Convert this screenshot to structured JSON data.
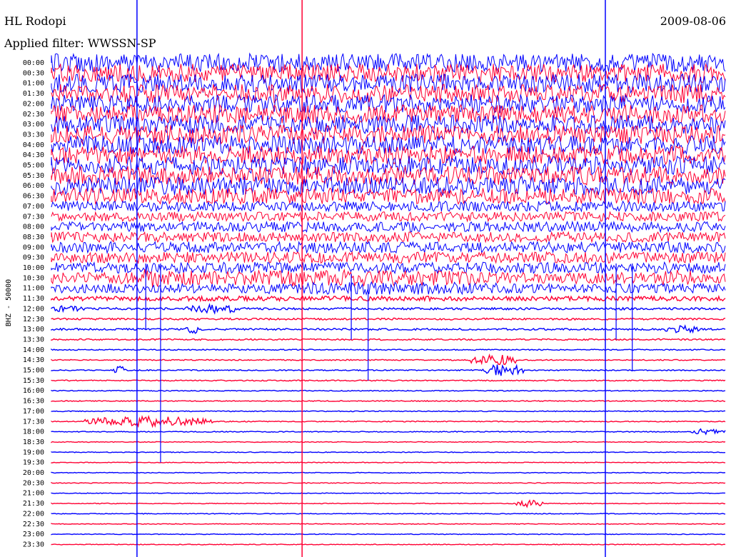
{
  "header": {
    "station": "HL Rodopi",
    "filter_text": "Applied filter: WWSSN-SP",
    "date": "2009-08-06"
  },
  "chart_data": {
    "type": "helicorder",
    "title": "HL Rodopi",
    "date": "2009-08-06",
    "filter": "WWSSN-SP",
    "channel_label": "BHZ - 50000",
    "row_interval_minutes": 30,
    "row_labels": [
      "00:00",
      "00:30",
      "01:00",
      "01:30",
      "02:00",
      "02:30",
      "03:00",
      "03:30",
      "04:00",
      "04:30",
      "05:00",
      "05:30",
      "06:00",
      "06:30",
      "07:00",
      "07:30",
      "08:00",
      "08:30",
      "09:00",
      "09:30",
      "10:00",
      "10:30",
      "11:00",
      "11:30",
      "12:00",
      "12:30",
      "13:00",
      "13:30",
      "14:00",
      "14:30",
      "15:00",
      "15:30",
      "16:00",
      "16:30",
      "17:00",
      "17:30",
      "18:00",
      "18:30",
      "19:00",
      "19:30",
      "20:00",
      "20:30",
      "21:00",
      "21:30",
      "22:00",
      "22:30",
      "23:00",
      "23:30"
    ],
    "trace_colors": [
      "#0000ff",
      "#ff0033"
    ],
    "row_noise_amplitude": [
      1.0,
      1.0,
      1.0,
      1.0,
      1.0,
      1.0,
      1.0,
      1.0,
      1.0,
      1.0,
      1.0,
      1.0,
      1.0,
      0.85,
      0.55,
      0.5,
      0.55,
      0.55,
      0.6,
      0.6,
      0.6,
      0.6,
      0.5,
      0.25,
      0.12,
      0.1,
      0.1,
      0.08,
      0.06,
      0.06,
      0.06,
      0.06,
      0.05,
      0.05,
      0.05,
      0.05,
      0.05,
      0.04,
      0.04,
      0.04,
      0.04,
      0.04,
      0.04,
      0.04,
      0.04,
      0.04,
      0.04,
      0.04
    ],
    "bursts": [
      {
        "row": 21,
        "x_start": 0.02,
        "x_end": 0.77,
        "amplitude": 0.9
      },
      {
        "row": 21,
        "x_start": 0.89,
        "x_end": 0.97,
        "amplitude": 0.9
      },
      {
        "row": 21,
        "x_start": 0.13,
        "x_end": 0.17,
        "amplitude": 1.2
      },
      {
        "row": 22,
        "x_start": 0.2,
        "x_end": 0.77,
        "amplitude": 0.7
      },
      {
        "row": 24,
        "x_start": 0.0,
        "x_end": 0.05,
        "amplitude": 0.35
      },
      {
        "row": 24,
        "x_start": 0.2,
        "x_end": 0.28,
        "amplitude": 0.5
      },
      {
        "row": 26,
        "x_start": 0.2,
        "x_end": 0.23,
        "amplitude": 0.45
      },
      {
        "row": 26,
        "x_start": 0.91,
        "x_end": 0.96,
        "amplitude": 0.4
      },
      {
        "row": 29,
        "x_start": 0.62,
        "x_end": 0.69,
        "amplitude": 0.6
      },
      {
        "row": 30,
        "x_start": 0.09,
        "x_end": 0.11,
        "amplitude": 0.45
      },
      {
        "row": 30,
        "x_start": 0.64,
        "x_end": 0.7,
        "amplitude": 0.7
      },
      {
        "row": 35,
        "x_start": 0.05,
        "x_end": 0.24,
        "amplitude": 0.55
      },
      {
        "row": 36,
        "x_start": 0.95,
        "x_end": 1.0,
        "amplitude": 0.35
      },
      {
        "row": 43,
        "x_start": 0.69,
        "x_end": 0.73,
        "amplitude": 0.4
      }
    ],
    "spikes": [
      {
        "x": 0.127,
        "row_from": 0,
        "row_to": 48,
        "color": "#0000ff"
      },
      {
        "x": 0.372,
        "row_from": 0,
        "row_to": 48,
        "color": "#ff0033"
      },
      {
        "x": 0.822,
        "row_from": 0,
        "row_to": 48,
        "color": "#0000ff"
      },
      {
        "x": 0.162,
        "row_from": 20,
        "row_to": 39,
        "color": "#0000ff"
      },
      {
        "x": 0.14,
        "row_from": 20,
        "row_to": 26,
        "color": "#0000ff"
      },
      {
        "x": 0.445,
        "row_from": 21,
        "row_to": 27,
        "color": "#0000ff"
      },
      {
        "x": 0.838,
        "row_from": 20,
        "row_to": 27,
        "color": "#0000ff"
      },
      {
        "x": 0.862,
        "row_from": 20,
        "row_to": 30,
        "color": "#0000ff"
      },
      {
        "x": 0.47,
        "row_from": 22,
        "row_to": 31,
        "color": "#0000ff"
      }
    ]
  }
}
